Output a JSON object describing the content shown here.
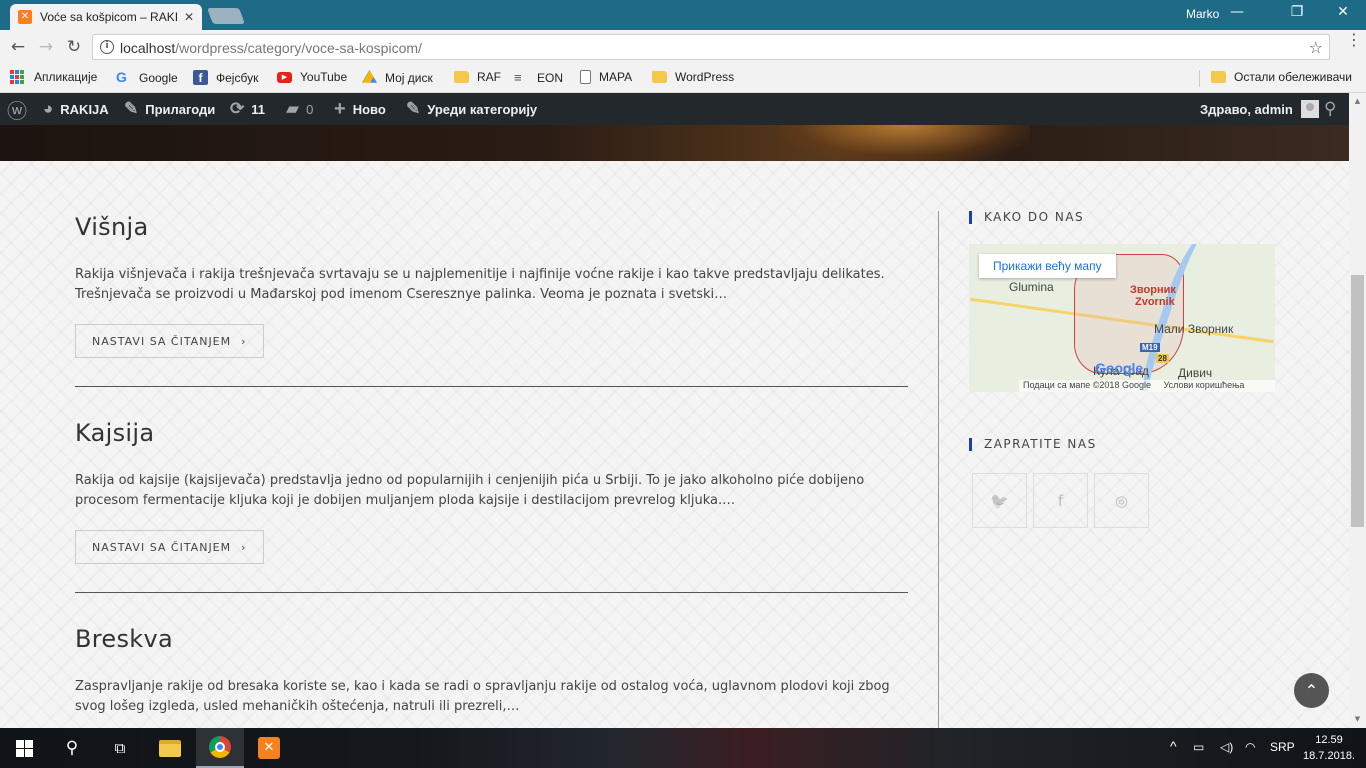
{
  "browser": {
    "tab_title": "Voće sa košpicom – RAKIJA",
    "tab_close": "✕",
    "user_name": "Marko",
    "window_controls": {
      "minimize": "—",
      "restore": "❐",
      "close": "✕"
    },
    "nav": {
      "back": "←",
      "forward": "→",
      "reload": "↻"
    },
    "url_host": "localhost",
    "url_path": "/wordpress/category/voce-sa-kospicom/",
    "bookmark_star": "☆",
    "menu_dots": "⋮",
    "bookmarks": [
      {
        "label": "Апликације",
        "icon": "apps-grid-icon"
      },
      {
        "label": "Google",
        "icon": "google-icon"
      },
      {
        "label": "Фејсбук",
        "icon": "facebook-icon"
      },
      {
        "label": "YouTube",
        "icon": "youtube-icon"
      },
      {
        "label": "Мој диск",
        "icon": "drive-icon"
      },
      {
        "label": "RAF",
        "icon": "folder-icon"
      },
      {
        "label": "EON",
        "icon": "eon-icon"
      },
      {
        "label": "MAPA",
        "icon": "page-icon"
      },
      {
        "label": "WordPress",
        "icon": "folder-icon"
      }
    ],
    "other_bookmarks": "Остали обележивачи"
  },
  "admin_bar": {
    "site_name": "RAKIJA",
    "customize": "Прилагоди",
    "updates_count": "11",
    "comments_count": "0",
    "new": "Ново",
    "edit_category": "Уреди категорију",
    "greeting": "Здраво, admin"
  },
  "posts": [
    {
      "title": "Višnja",
      "excerpt": "Rakija višnjevača i rakija trešnjevača svrtavaju se u  najplemenitije i najfinije voćne rakije i kao takve predstavljaju delikates. Trešnjevača se proizvodi u Mađarskoj pod imenom Cseresznye palinka. Veoma je poznata i svetski…",
      "read_more": "NASTAVI SA ČITANJEM"
    },
    {
      "title": "Kajsija",
      "excerpt": "Rakija od kajsije (kajsijevača) predstavlja jedno od popularnijih i cenjenijih pića u Srbiji. To je jako alkoholno piće dobijeno procesom fermentacije kljuka koji je dobijen muljanjem ploda kajsije i destilacijom prevrelog kljuka.…",
      "read_more": "NASTAVI SA ČITANJEM"
    },
    {
      "title": "Breskva",
      "excerpt": "Zaspravljanje rakije od bresaka koriste se, kao i kada se radi o spravljanju rakije od ostalog voća, uglavnom plodovi koji zbog svog lošeg izgleda, usled mehaničkih oštećenja, natruli ili prezreli,…"
    }
  ],
  "sidebar": {
    "map_widget_title": "KAKO DO NAS",
    "map": {
      "view_larger": "Прикажи већу мапу",
      "places": {
        "glumina": "Glumina",
        "zvornik_cyr": "Зворник",
        "zvornik_lat": "Zvornik",
        "mali_zvornik": "Мали Зворник",
        "kula_grad": "Кула Град",
        "divic": "Дивич"
      },
      "road_m19": "M19",
      "road_28": "28",
      "google": "Google",
      "footer_data": "Подаци са мапе ©2018 Google",
      "footer_terms": "Услови коришћења"
    },
    "follow_widget_title": "ZAPRATITE NAS",
    "social": [
      {
        "icon": "twitter-icon",
        "glyph": "🐦"
      },
      {
        "icon": "facebook-icon",
        "glyph": "f"
      },
      {
        "icon": "instagram-icon",
        "glyph": "◎"
      }
    ]
  },
  "scroll_top": "⌃",
  "taskbar": {
    "language": "SRP",
    "time": "12.59",
    "date": "18.7.2018."
  },
  "colors": {
    "admin_bar": "#23282d",
    "accent": "#1b3fae",
    "tab_strip": "#1e6b87"
  }
}
